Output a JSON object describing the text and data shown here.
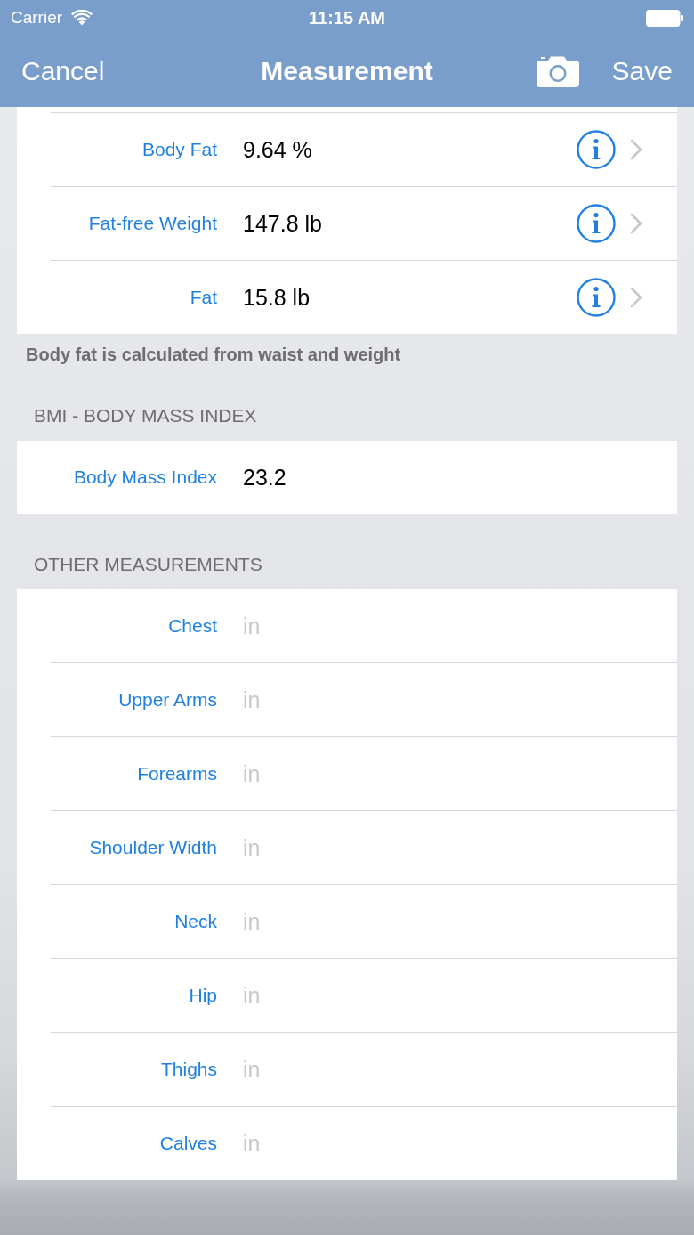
{
  "status_bar": {
    "carrier": "Carrier",
    "time": "11:15 AM"
  },
  "nav_bar": {
    "left_button": "Cancel",
    "title": "Measurement",
    "right_button": "Save"
  },
  "sections": [
    {
      "rows": [
        {
          "kind": "detail",
          "label": "Body Fat",
          "value": "9.64 %"
        },
        {
          "kind": "detail",
          "label": "Fat-free Weight",
          "value": "147.8 lb"
        },
        {
          "kind": "detail",
          "label": "Fat",
          "value": "15.8 lb"
        }
      ],
      "footer": "Body fat is calculated from waist and weight"
    },
    {
      "header": "BMI - BODY MASS INDEX",
      "rows": [
        {
          "kind": "value",
          "label": "Body Mass Index",
          "value": "23.2"
        }
      ]
    },
    {
      "header": "OTHER MEASUREMENTS",
      "rows": [
        {
          "kind": "input",
          "label": "Chest",
          "placeholder": "in"
        },
        {
          "kind": "input",
          "label": "Upper Arms",
          "placeholder": "in"
        },
        {
          "kind": "input",
          "label": "Forearms",
          "placeholder": "in"
        },
        {
          "kind": "input",
          "label": "Shoulder Width",
          "placeholder": "in"
        },
        {
          "kind": "input",
          "label": "Neck",
          "placeholder": "in"
        },
        {
          "kind": "input",
          "label": "Hip",
          "placeholder": "in"
        },
        {
          "kind": "input",
          "label": "Thighs",
          "placeholder": "in"
        },
        {
          "kind": "input",
          "label": "Calves",
          "placeholder": "in"
        }
      ]
    }
  ]
}
